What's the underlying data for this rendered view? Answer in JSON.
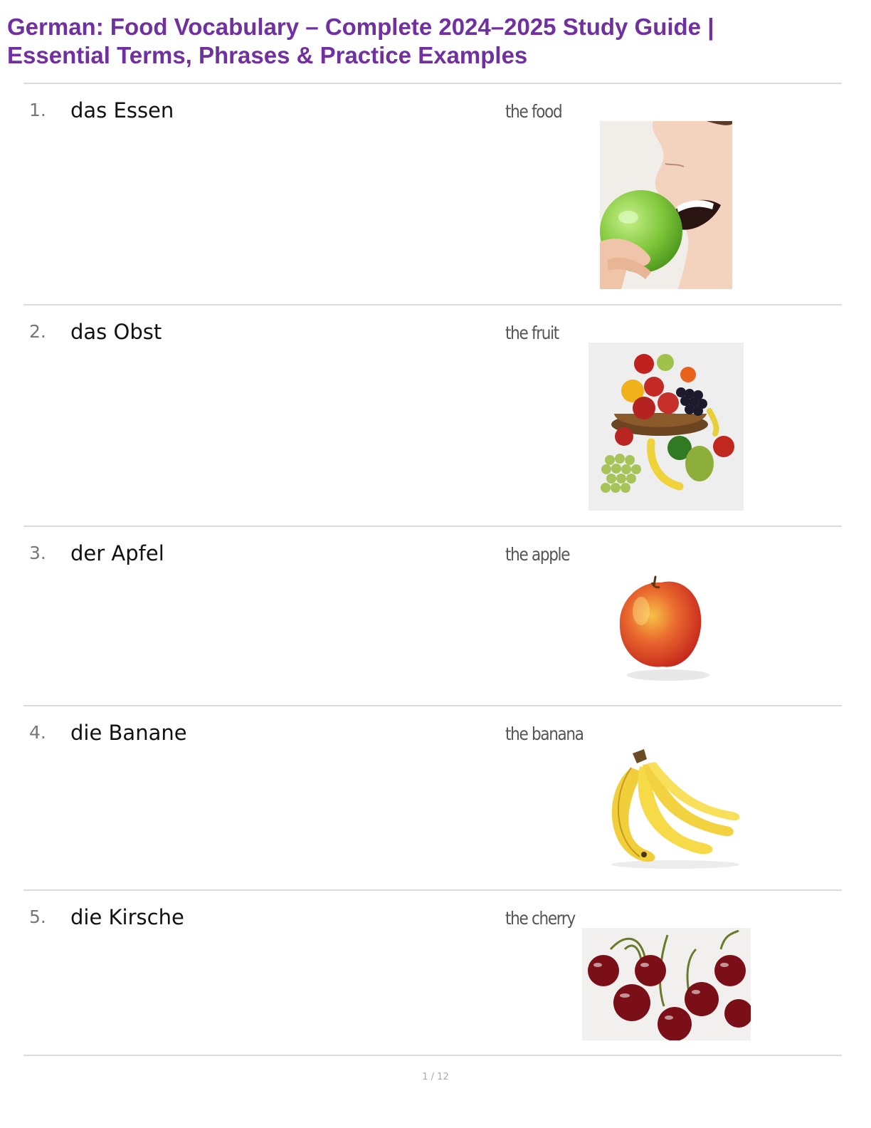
{
  "document": {
    "title_line1": "German: Food Vocabulary – Complete 2024–2025 Study Guide |",
    "title_line2": "Essential Terms, Phrases & Practice Examples"
  },
  "entries": [
    {
      "number": "1.",
      "term": "das Essen",
      "translation": "the food",
      "image_icon": "woman-eating-apple-photo"
    },
    {
      "number": "2.",
      "term": "das Obst",
      "translation": "the fruit",
      "image_icon": "fruit-bowl-photo"
    },
    {
      "number": "3.",
      "term": "der Apfel",
      "translation": "the apple",
      "image_icon": "apple-photo"
    },
    {
      "number": "4.",
      "term": "die Banane",
      "translation": "the banana",
      "image_icon": "banana-bunch-photo"
    },
    {
      "number": "5.",
      "term": "die Kirsche",
      "translation": "the cherry",
      "image_icon": "cherries-photo"
    }
  ],
  "footer": {
    "page_indicator": "1 / 12"
  },
  "colors": {
    "title": "#7030a0",
    "separator": "#dcdcdc"
  }
}
